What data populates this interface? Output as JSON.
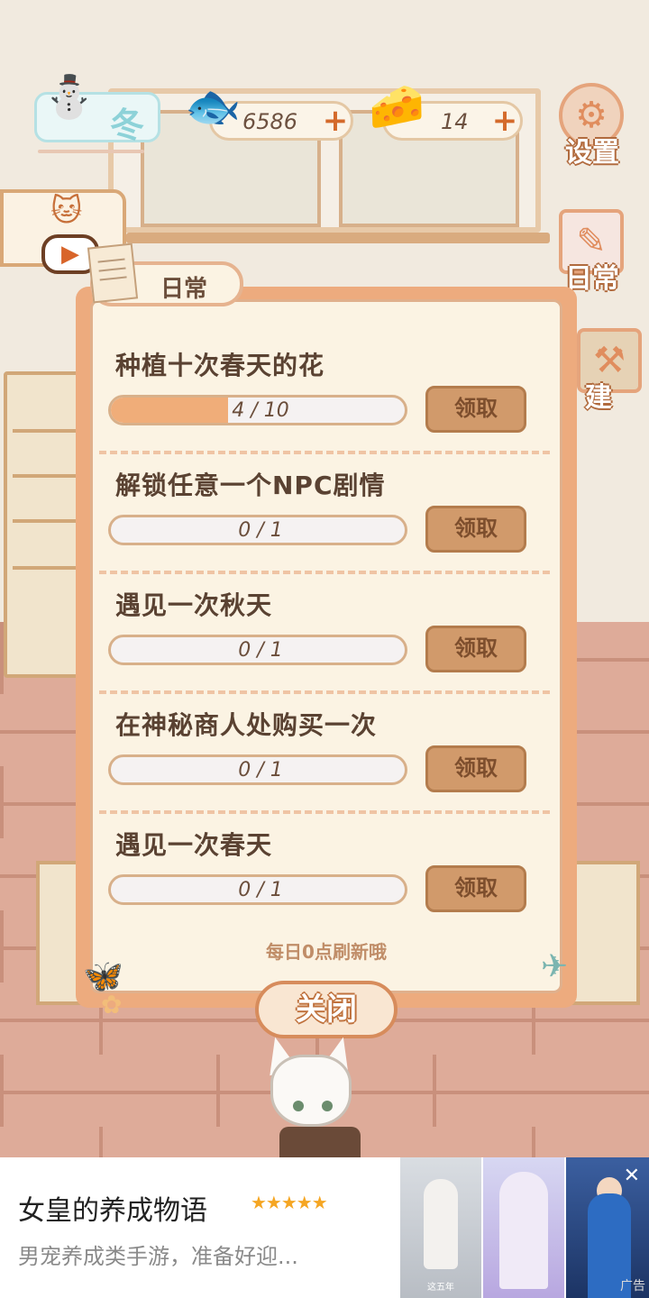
{
  "hud": {
    "season_label": "冬",
    "coins_value": "6586",
    "cheese_value": "14",
    "plus_symbol": "+"
  },
  "side_menu": {
    "settings_label": "设置",
    "daily_label": "日常",
    "build_label": "建"
  },
  "daily_panel": {
    "tab_label": "日常",
    "tasks": [
      {
        "title": "种植十次春天的花",
        "progress": "4 / 10",
        "current": 4,
        "total": 10,
        "claim_label": "领取"
      },
      {
        "title": "解锁任意一个NPC剧情",
        "progress": "0 / 1",
        "current": 0,
        "total": 1,
        "claim_label": "领取"
      },
      {
        "title": "遇见一次秋天",
        "progress": "0 / 1",
        "current": 0,
        "total": 1,
        "claim_label": "领取"
      },
      {
        "title": "在神秘商人处购买一次",
        "progress": "0 / 1",
        "current": 0,
        "total": 1,
        "claim_label": "领取"
      },
      {
        "title": "遇见一次春天",
        "progress": "0 / 1",
        "current": 0,
        "total": 1,
        "claim_label": "领取"
      }
    ],
    "refresh_note": "每日0点刷新哦",
    "close_label": "关闭"
  },
  "ad": {
    "title": "女皇的养成物语",
    "stars": "★★★★★",
    "description": "男宠养成类手游，准备好迎...",
    "thumb1_caption": "这五年",
    "close_symbol": "✕",
    "ad_mark": "广告"
  },
  "colors": {
    "accent": "#edab7e",
    "progress_fill": "#f0ad79",
    "claim_button": "#d19a6b"
  },
  "icons": [
    "winter-tree-icon",
    "fish-bone-icon",
    "cheese-icon",
    "gear-icon",
    "tip-note-icon",
    "build-icon",
    "play-icon",
    "butterfly-icon",
    "dragonfly-icon"
  ]
}
